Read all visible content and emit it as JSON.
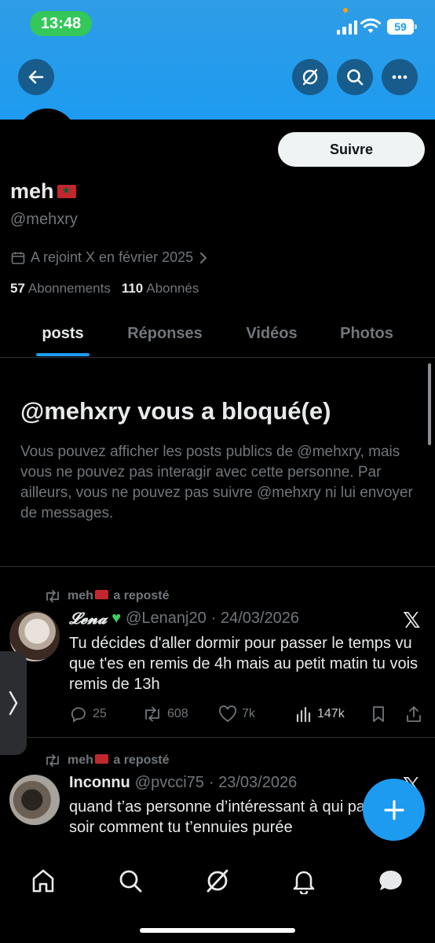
{
  "status": {
    "time": "13:48",
    "battery": "59"
  },
  "profile": {
    "follow_label": "Suivre",
    "display_name": "meh",
    "handle": "@mehxry",
    "joined": "A rejoint X en février 2025",
    "following_count": "57",
    "following_label": "Abonnements",
    "followers_count": "110",
    "followers_label": "Abonnés"
  },
  "tabs": [
    {
      "label": "posts"
    },
    {
      "label": "Réponses"
    },
    {
      "label": "Vidéos"
    },
    {
      "label": "Photos"
    }
  ],
  "blocked": {
    "title": "@mehxry vous a bloqué(e)",
    "text": "Vous pouvez afficher les posts publics de @mehxry, mais vous ne pouvez pas interagir avec cette personne. Par ailleurs, vous ne pouvez pas suivre @mehxry ni lui envoyer de messages."
  },
  "posts": [
    {
      "repost_label": "meh",
      "repost_suffix": "a reposté",
      "author": "𝓛𝓮𝓷𝓪",
      "handle": "@Lenanj20",
      "date": "· 24/03/2026",
      "text": "Tu décides d'aller dormir pour passer le temps vu que t'es en remis de 4h mais au petit matin tu vois remis de 13h",
      "replies": "25",
      "reposts": "608",
      "likes": "7k",
      "views": "147k"
    },
    {
      "repost_label": "meh",
      "repost_suffix": "a reposté",
      "author": "Inconnu",
      "handle": "@pvcci75",
      "date": "· 23/03/2026",
      "text": "quand t’as personne d’intéressant à qui parler le soir comment tu t’ennuies purée"
    }
  ],
  "colors": {
    "accent": "#1d9bf0",
    "background": "#000000",
    "muted": "#71767b"
  }
}
